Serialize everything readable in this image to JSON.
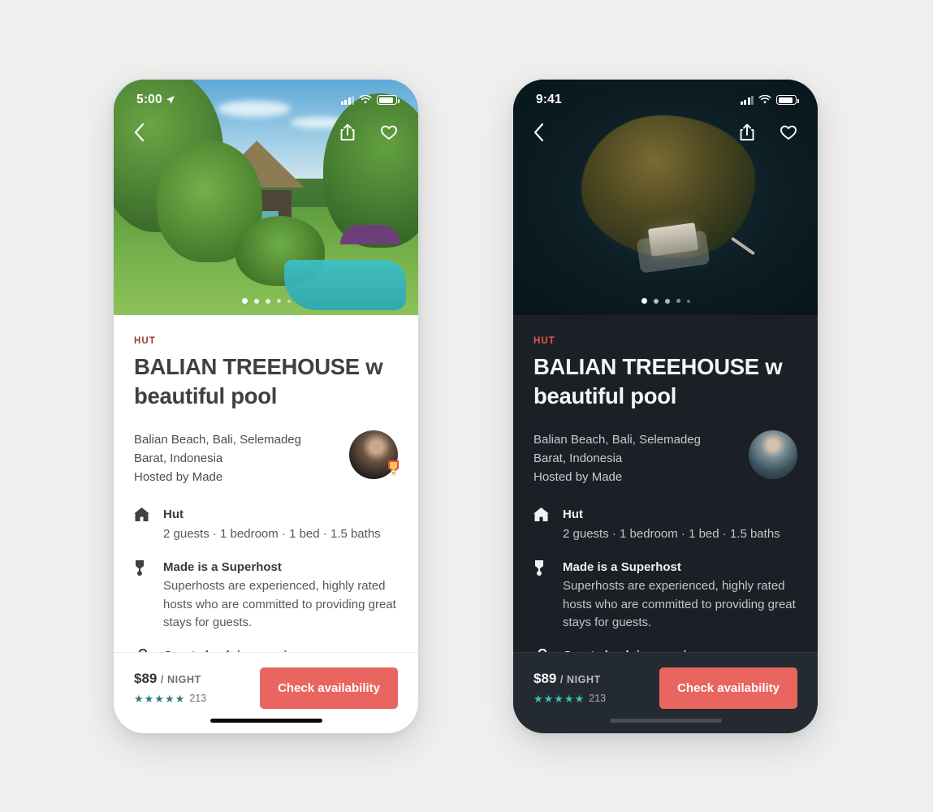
{
  "page": {
    "background_color": "#efefee",
    "accent_coral": "#e8665f",
    "kicker_color_light": "#9b3b34",
    "kicker_color_dark": "#e8594e",
    "star_color_light": "#2f7a80",
    "star_color_dark": "#3dbfb5"
  },
  "listing": {
    "kicker": "HUT",
    "title": "BALIAN TREEHOUSE w beautiful pool",
    "address_line_1": "Balian Beach, Bali, Selemadeg",
    "address_line_2": "Barat, Indonesia",
    "host_line": "Hosted by Made",
    "features": [
      {
        "icon": "hut-icon",
        "heading": "Hut",
        "body": "2 guests · 1 bedroom · 1 bed · 1.5 baths"
      },
      {
        "icon": "superhost-medal-icon",
        "heading": "Made is a Superhost",
        "body": "Superhosts are experienced, highly rated hosts who are committed to providing great stays for guests."
      },
      {
        "icon": "key-icon",
        "heading": "Great check-in experience",
        "body": ""
      }
    ],
    "price": "$89",
    "price_period": "/ NIGHT",
    "stars": "★★★★★",
    "review_count": "213",
    "cta_label": "Check availability",
    "carousel_dots": 5,
    "carousel_active_index": 0
  },
  "phone_light": {
    "theme": "light",
    "status_time": "5:00",
    "status_location_arrow": "➤",
    "photo_alt": "Balian treehouse with thatched roof, tropical garden and turquoise pool"
  },
  "phone_dark": {
    "theme": "dark",
    "status_time": "9:41",
    "photo_alt": "Aerial view of a house on a small forested island at dusk"
  },
  "icons": {
    "back": "chevron-left-icon",
    "share": "share-icon",
    "favorite": "heart-outline-icon",
    "signal": "cellular-signal-icon",
    "wifi": "wifi-icon",
    "battery": "battery-icon"
  }
}
